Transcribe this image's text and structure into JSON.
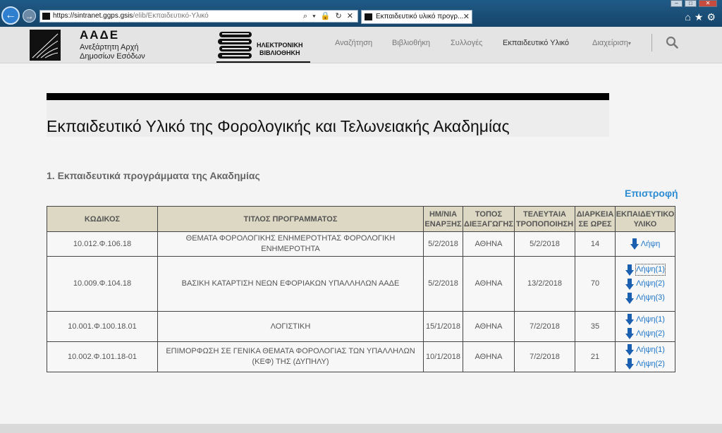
{
  "browser": {
    "url_host": "https://sintranet.ggps.gsis",
    "url_path": "/elib/Εκπαιδευτικό-Υλικό",
    "tab_title": "Εκπαιδευτικό υλικό προγρ...",
    "tab_close": "✕",
    "address_tools": "⌕ ▾ 🔒 ↻ ✕",
    "win_minimize": "–",
    "win_maximize": "□",
    "win_close": "✕",
    "icons": [
      "home-icon",
      "star-icon",
      "gear-icon"
    ]
  },
  "header": {
    "org_name": "ΑΑΔΕ",
    "org_sub_1": "Ανεξάρτητη Αρχή",
    "org_sub_2": "Δημοσίων Εσόδων",
    "lib_line_1": "ΗΛΕΚΤΡΟΝΙΚΗ",
    "lib_line_2": "ΒΙΒΛΙΟΘΗΚΗ",
    "nav": [
      {
        "label": "Αναζήτηση"
      },
      {
        "label": "Βιβλιοθήκη"
      },
      {
        "label": "Συλλογές"
      },
      {
        "label": "Εκπαιδευτικό Υλικό"
      },
      {
        "label": "Διαχείριση"
      }
    ]
  },
  "page": {
    "title": "Εκπαιδευτικό Υλικό της Φορολογικής και Τελωνειακής Ακαδημίας",
    "section": "1. Εκπαιδευτικά προγράμματα της Ακαδημίας",
    "back_link": "Επιστροφή"
  },
  "table": {
    "headers": [
      {
        "l1": "ΚΩΔΙΚΟΣ",
        "l2": ""
      },
      {
        "l1": "ΤΙΤΛΟΣ ΠΡΟΓΡΑΜΜΑΤΟΣ",
        "l2": ""
      },
      {
        "l1": "ΗΜ/ΝΙΑ",
        "l2": "ΕΝΑΡΞΗΣ"
      },
      {
        "l1": "ΤΟΠΟΣ",
        "l2": "ΔΙΕΞΑΓΩΓΗΣ"
      },
      {
        "l1": "ΤΕΛΕΥΤΑΙΑ",
        "l2": "ΤΡΟΠΟΠΟΙΗΣΗ"
      },
      {
        "l1": "ΔΙΑΡΚΕΙΑ",
        "l2": "ΣΕ ΩΡΕΣ"
      },
      {
        "l1": "ΕΚΠΑΙΔΕΥΤΙΚΟ",
        "l2": "ΥΛΙΚΟ"
      }
    ],
    "rows": [
      {
        "code": "10.012.Φ.106.18",
        "title_1": "ΘΕΜΑΤΑ ΦΟΡΟΛΟΓΙΚΗΣ ΕΝΗΜΕΡΟΤΗΤΑΣ ΦΟΡΟΛΟΓΙΚΗ",
        "title_2": "ΕΝΗΜΕΡΟΤΗΤΑ",
        "start": "5/2/2018",
        "place": "ΑΘΗΝΑ",
        "modified": "5/2/2018",
        "hours": "14",
        "downloads": [
          "Λήψη"
        ]
      },
      {
        "code": "10.009.Φ.104.18",
        "title_1": "ΒΑΣΙΚΗ ΚΑΤΑΡΤΙΣΗ ΝΕΩΝ ΕΦΟΡΙΑΚΩΝ ΥΠΑΛΛΗΛΩΝ ΑΑΔΕ",
        "title_2": "",
        "start": "5/2/2018",
        "place": "ΑΘΗΝΑ",
        "modified": "13/2/2018",
        "hours": "70",
        "downloads": [
          "Λήψη(1)",
          "Λήψη(2)",
          "Λήψη(3)"
        ]
      },
      {
        "code": "10.001.Φ.100.18.01",
        "title_1": "ΛΟΓΙΣΤΙΚΗ",
        "title_2": "",
        "start": "15/1/2018",
        "place": "ΑΘΗΝΑ",
        "modified": "7/2/2018",
        "hours": "35",
        "downloads": [
          "Λήψη(1)",
          "Λήψη(2)"
        ]
      },
      {
        "code": "10.002.Φ.101.18-01",
        "title_1": "ΕΠΙΜΟΡΦΩΣΗ ΣΕ ΓΕΝΙΚΑ ΘΕΜΑΤΑ ΦΟΡΟΛΟΓΙΑΣ ΤΩΝ ΥΠΑΛΛΗΛΩΝ",
        "title_2": "(ΚΕΦ) ΤΗΣ (ΔΥΠΗΛΥ)",
        "start": "10/1/2018",
        "place": "ΑΘΗΝΑ",
        "modified": "7/2/2018",
        "hours": "21",
        "downloads": [
          "Λήψη(1)",
          "Λήψη(2)"
        ]
      }
    ]
  },
  "colors": {
    "link": "#2b8bd3",
    "table_header_bg": "#dcd8c3",
    "browser_chrome": "#1f5a86"
  }
}
